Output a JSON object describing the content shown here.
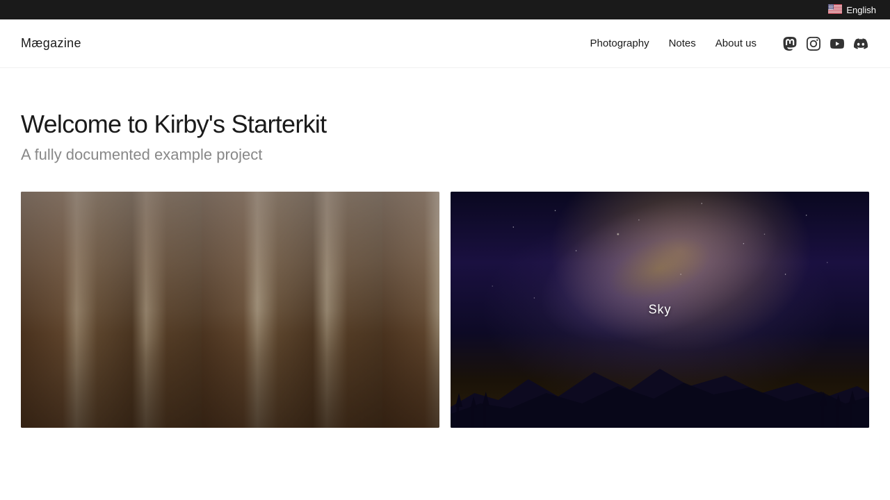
{
  "topbar": {
    "lang": "English"
  },
  "header": {
    "logo": "Mægazine",
    "nav": {
      "photography": "Photography",
      "notes": "Notes",
      "about": "About us"
    },
    "social": {
      "mastodon": "mastodon",
      "instagram": "instagram",
      "youtube": "youtube",
      "discord": "discord"
    }
  },
  "hero": {
    "title": "Welcome to Kirby's Starterkit",
    "subtitle": "A fully documented example project"
  },
  "gallery": {
    "items": [
      {
        "id": "forest",
        "label": "",
        "alt": "Tall sequoia trees in misty forest"
      },
      {
        "id": "sky",
        "label": "Sky",
        "alt": "Milky way over mountain silhouette at night"
      }
    ]
  }
}
